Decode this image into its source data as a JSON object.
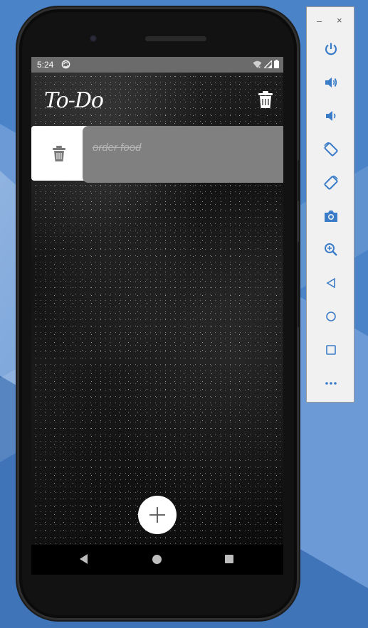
{
  "app": {
    "title": "To-Do",
    "title_color": "#ffffff",
    "background": "dark sand texture"
  },
  "status_bar": {
    "time": "5:24",
    "icons": [
      "sync-icon",
      "wifi-icon",
      "signal-icon",
      "battery-icon"
    ],
    "background": "#6b6b6b"
  },
  "todos": [
    {
      "text": "order food",
      "completed": true,
      "swipe_action_icon": "trash-icon"
    }
  ],
  "fab": {
    "icon": "plus-icon"
  },
  "nav_bar": {
    "items": [
      "back-icon",
      "home-icon",
      "recents-icon"
    ]
  },
  "emulator_toolbar": {
    "window_controls": {
      "minimize": "–",
      "close": "×"
    },
    "buttons": [
      "power-icon",
      "volume-up-icon",
      "volume-down-icon",
      "rotate-left-icon",
      "rotate-right-icon",
      "camera-icon",
      "zoom-icon",
      "back-icon",
      "home-icon",
      "overview-icon",
      "more-icon"
    ]
  },
  "colors": {
    "card": "#808080",
    "card_text": "#b5b5b5",
    "desktop": "#4f86c6",
    "toolbar_icons": "#3b7cc9"
  }
}
